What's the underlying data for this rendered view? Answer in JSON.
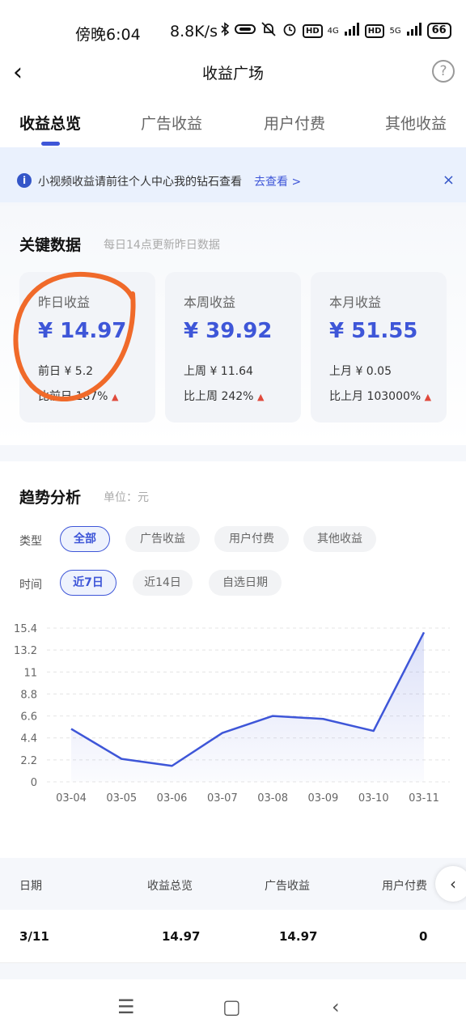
{
  "status_bar": {
    "time": "傍晚6:04",
    "net_speed": "8.8K/s",
    "icons": [
      "bluetooth-icon",
      "vibrate-icon",
      "mute-icon",
      "alarm-icon",
      "hd-icon",
      "signal-4g-icon",
      "hd-icon",
      "signal-5g-icon"
    ],
    "hd1": "HD",
    "g4": "4G",
    "hd2": "HD",
    "g5": "5G",
    "battery": "66"
  },
  "nav": {
    "back": "‹",
    "title": "收益广场",
    "help": "?"
  },
  "tabs": [
    {
      "label": "收益总览",
      "active": true
    },
    {
      "label": "广告收益",
      "active": false
    },
    {
      "label": "用户付费",
      "active": false
    },
    {
      "label": "其他收益",
      "active": false
    }
  ],
  "notice": {
    "icon": "i",
    "message": "小视频收益请前往个人中心我的钻石查看",
    "link": "去查看 >",
    "close": "×"
  },
  "key_data": {
    "title": "关键数据",
    "subtitle": "每日14点更新昨日数据",
    "cards": [
      {
        "label": "昨日收益",
        "value": "¥ 14.97",
        "prev": "前日 ¥ 5.2",
        "compare": "比前日 187%",
        "trend": "▲"
      },
      {
        "label": "本周收益",
        "value": "¥ 39.92",
        "prev": "上周 ¥ 11.64",
        "compare": "比上周 242%",
        "trend": "▲"
      },
      {
        "label": "本月收益",
        "value": "¥ 51.55",
        "prev": "上月 ¥ 0.05",
        "compare": "比上月 103000%",
        "trend": "▲"
      }
    ]
  },
  "trend": {
    "title": "趋势分析",
    "unit": "单位：元",
    "type_label": "类型",
    "type_options": [
      {
        "label": "全部",
        "active": true
      },
      {
        "label": "广告收益",
        "active": false
      },
      {
        "label": "用户付费",
        "active": false
      },
      {
        "label": "其他收益",
        "active": false
      }
    ],
    "time_label": "时间",
    "time_options": [
      {
        "label": "近7日",
        "active": true
      },
      {
        "label": "近14日",
        "active": false
      },
      {
        "label": "自选日期",
        "active": false
      }
    ]
  },
  "chart_data": {
    "type": "area",
    "x": [
      "03-04",
      "03-05",
      "03-06",
      "03-07",
      "03-08",
      "03-09",
      "03-10",
      "03-11"
    ],
    "series": [
      {
        "values": [
          5.3,
          2.3,
          1.6,
          4.9,
          6.6,
          6.3,
          5.1,
          14.97
        ]
      }
    ],
    "yticks": [
      "0",
      "2.2",
      "4.4",
      "6.6",
      "8.8",
      "11",
      "13.2",
      "15.4"
    ],
    "ylim": [
      0,
      15.4
    ],
    "grid": true,
    "line_color": "#3e56d8"
  },
  "table": {
    "headers": [
      "日期",
      "收益总览",
      "广告收益",
      "用户付费"
    ],
    "rows": [
      [
        "3/11",
        "14.97",
        "14.97",
        "0"
      ]
    ],
    "expand": "‹"
  },
  "system_nav": {
    "menu": "☰",
    "home": "▢",
    "back": "‹"
  }
}
